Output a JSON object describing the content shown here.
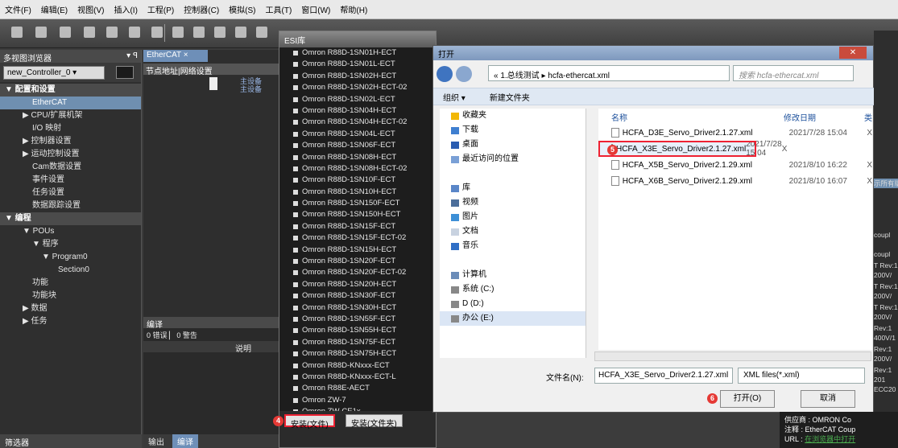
{
  "menubar": [
    "文件(F)",
    "编辑(E)",
    "视图(V)",
    "插入(I)",
    "工程(P)",
    "控制器(C)",
    "模拟(S)",
    "工具(T)",
    "窗口(W)",
    "帮助(H)"
  ],
  "left_pane": {
    "title": "多视图浏览器",
    "pin": "▾ ꟼ",
    "controller": "new_Controller_0 ▾",
    "tree": [
      {
        "label": "▼ 配置和设置",
        "cls": "sec"
      },
      {
        "label": "EtherCAT",
        "cls": "sel",
        "indent": 40
      },
      {
        "label": "▶ CPU/扩展机架",
        "indent": 28
      },
      {
        "label": "I/O 映射",
        "indent": 40
      },
      {
        "label": "▶ 控制器设置",
        "indent": 28
      },
      {
        "label": "▶ 运动控制设置",
        "indent": 28
      },
      {
        "label": "Cam数据设置",
        "indent": 40
      },
      {
        "label": "事件设置",
        "indent": 40
      },
      {
        "label": "任务设置",
        "indent": 40
      },
      {
        "label": "数据跟踪设置",
        "indent": 40
      },
      {
        "label": "▼ 编程",
        "cls": "sec"
      },
      {
        "label": "▼ POUs",
        "indent": 28
      },
      {
        "label": "▼ 程序",
        "indent": 40
      },
      {
        "label": "▼ Program0",
        "indent": 52
      },
      {
        "label": "Section0",
        "indent": 72
      },
      {
        "label": "功能",
        "indent": 40
      },
      {
        "label": "功能块",
        "indent": 40
      },
      {
        "label": "▶ 数据",
        "indent": 28
      },
      {
        "label": "▶ 任务",
        "indent": 28
      }
    ],
    "status": "筛选器"
  },
  "center": {
    "tab": "EtherCAT ×",
    "grid_header": "节点地址|网络设置",
    "master1": "主设备",
    "master2": "主设备",
    "compile_title": "编译",
    "compile_filter": "0 错误 ▏ 0 警告",
    "compile_col": "说明",
    "bottom_tabs": [
      "输出",
      "编译"
    ]
  },
  "esi": {
    "title": "ESI库",
    "items": [
      "Omron R88D-1SN01H-ECT",
      "Omron R88D-1SN01L-ECT",
      "Omron R88D-1SN02H-ECT",
      "Omron R88D-1SN02H-ECT-02",
      "Omron R88D-1SN02L-ECT",
      "Omron R88D-1SN04H-ECT",
      "Omron R88D-1SN04H-ECT-02",
      "Omron R88D-1SN04L-ECT",
      "Omron R88D-1SN06F-ECT",
      "Omron R88D-1SN08H-ECT",
      "Omron R88D-1SN08H-ECT-02",
      "Omron R88D-1SN10F-ECT",
      "Omron R88D-1SN10H-ECT",
      "Omron R88D-1SN150F-ECT",
      "Omron R88D-1SN150H-ECT",
      "Omron R88D-1SN15F-ECT",
      "Omron R88D-1SN15F-ECT-02",
      "Omron R88D-1SN15H-ECT",
      "Omron R88D-1SN20F-ECT",
      "Omron R88D-1SN20F-ECT-02",
      "Omron R88D-1SN20H-ECT",
      "Omron R88D-1SN30F-ECT",
      "Omron R88D-1SN30H-ECT",
      "Omron R88D-1SN55F-ECT",
      "Omron R88D-1SN55H-ECT",
      "Omron R88D-1SN75F-ECT",
      "Omron R88D-1SN75H-ECT",
      "Omron R88D-KNxxx-ECT",
      "Omron R88D-KNxxx-ECT-L",
      "Omron R88E-AECT",
      "Omron ZW-7",
      "Omron ZW-CE1x",
      "HCFA_X6B_Servo_Driver2.1.29"
    ],
    "btn_install_file": "安装(文件)",
    "btn_install_folder": "安装(文件夹)",
    "badge4": "4"
  },
  "open": {
    "title": "打开",
    "path": "« 1.总线测试 ▸ hcfa-ethercat.xml",
    "search_placeholder": "搜索 hcfa-ethercat.xml",
    "cmd_organize": "组织 ▾",
    "cmd_newfolder": "新建文件夹",
    "nav": [
      {
        "label": "收藏夹",
        "ic": "#f2b705"
      },
      {
        "label": "下载",
        "ic": "#3f7fd0"
      },
      {
        "label": "桌面",
        "ic": "#2a5cb0"
      },
      {
        "label": "最近访问的位置",
        "ic": "#7aa0d6"
      },
      {
        "label": "",
        "ic": ""
      },
      {
        "label": "库",
        "ic": "#5a86c8"
      },
      {
        "label": "视频",
        "ic": "#4c6e9a"
      },
      {
        "label": "图片",
        "ic": "#3d8fd6"
      },
      {
        "label": "文档",
        "ic": "#c8d2e0"
      },
      {
        "label": "音乐",
        "ic": "#2f6fc6"
      },
      {
        "label": "",
        "ic": ""
      },
      {
        "label": "计算机",
        "ic": "#6b8cb8"
      },
      {
        "label": "系统 (C:)",
        "ic": "#888"
      },
      {
        "label": "D (D:)",
        "ic": "#888"
      },
      {
        "label": "办公 (E:)",
        "ic": "#888"
      }
    ],
    "col_name": "名称",
    "col_date": "修改日期",
    "col_type": "类",
    "files": [
      {
        "name": "HCFA_D3E_Servo_Driver2.1.27.xml",
        "date": "2021/7/28 15:04",
        "type": "X"
      },
      {
        "name": "HCFA_X3E_Servo_Driver2.1.27.xml",
        "date": "2021/7/28 15:04",
        "type": "X"
      },
      {
        "name": "HCFA_X5B_Servo_Driver2.1.29.xml",
        "date": "2021/8/10 16:22",
        "type": "X"
      },
      {
        "name": "HCFA_X6B_Servo_Driver2.1.29.xml",
        "date": "2021/8/10 16:07",
        "type": "X"
      }
    ],
    "filename_label": "文件名(N):",
    "filename_value": "HCFA_X3E_Servo_Driver2.1.27.xml",
    "filetype": "XML files(*.xml)",
    "btn_open": "打开(O)",
    "btn_cancel": "取消",
    "badge5": "5",
    "badge6": "6"
  },
  "right": {
    "strip": [
      "示所有版",
      "",
      "coupl",
      "coupl",
      "T Rev:1",
      "200V/",
      "T Rev:1",
      "200V/",
      "T Rev:1",
      "200V/",
      "Rev:1",
      "400V/1",
      "Rev:1",
      "200V/",
      "Rev:1",
      "201",
      "ECC20"
    ],
    "bottom1": "供应商 : OMRON Co",
    "bottom2": "注释 : EtherCAT Coup",
    "bottom3_label": "URL : ",
    "bottom3_link": "在浏览器中打开"
  }
}
